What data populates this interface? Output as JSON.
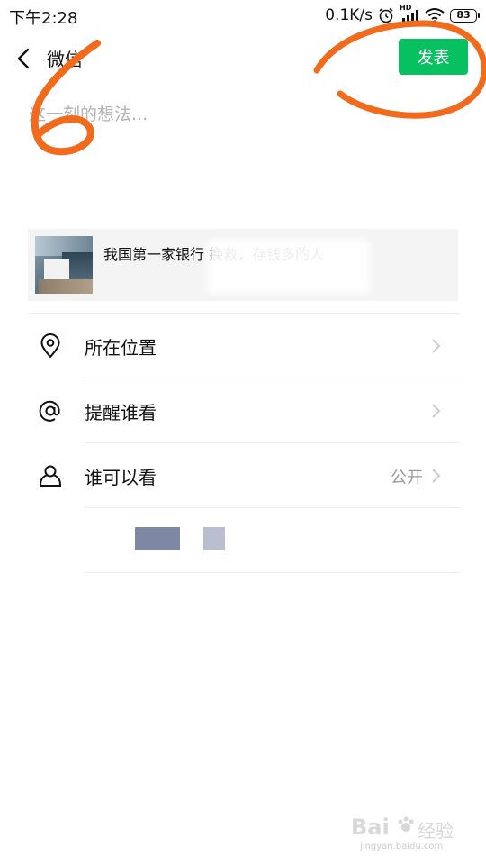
{
  "status_bar": {
    "time": "下午2:28",
    "network_speed": "0.1K/s",
    "hd_label": "HD",
    "battery_level": "83",
    "icons": [
      "alarm-icon",
      "signal-icon",
      "wifi-icon",
      "battery-icon"
    ]
  },
  "header": {
    "title": "微信",
    "publish_label": "发表"
  },
  "compose": {
    "placeholder": "这一刻的想法..."
  },
  "link_card": {
    "text": "我国第一家银行                               挽救，存钱多的人"
  },
  "options": [
    {
      "label": "所在位置",
      "value": "",
      "icon": "location-pin-icon"
    },
    {
      "label": "提醒谁看",
      "value": "",
      "icon": "at-sign-icon"
    },
    {
      "label": "谁可以看",
      "value": "公开",
      "icon": "person-icon"
    }
  ],
  "annotation": {
    "digit": "6",
    "color": "#f26a1b"
  },
  "watermark": {
    "brand": "Bai",
    "product": "经验",
    "url": "jingyan.baidu.com"
  },
  "colors": {
    "accent": "#07c160",
    "placeholder": "#b3b3b3",
    "secondary_text": "#9a9a9a"
  }
}
